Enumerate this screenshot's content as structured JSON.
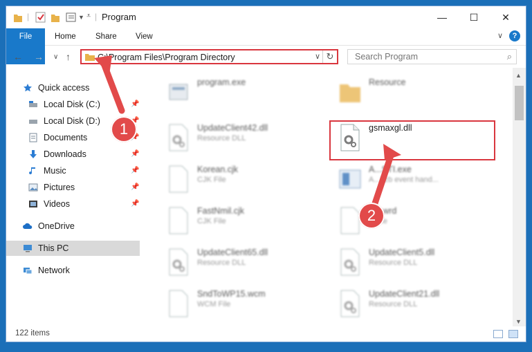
{
  "window": {
    "title": "Program",
    "controls": {
      "minimize": "—",
      "maximize": "☐",
      "close": "✕"
    }
  },
  "ribbon": {
    "tabs": [
      "File",
      "Home",
      "Share",
      "View"
    ],
    "expand": "∨",
    "help": "?"
  },
  "nav": {
    "back": "←",
    "forward": "→",
    "recent": "∨",
    "up": "↑"
  },
  "address": {
    "path": "C:\\Program Files\\Program Directory",
    "dropdown": "∨",
    "refresh": "↻"
  },
  "search": {
    "placeholder": "Search Program",
    "icon": "⌕"
  },
  "sidebar": {
    "items": [
      {
        "label": "Quick access",
        "icon": "star-icon"
      },
      {
        "label": "Local Disk (C:)",
        "icon": "drive-icon",
        "pinned": true
      },
      {
        "label": "Local Disk (D:)",
        "icon": "drive-icon",
        "pinned": true
      },
      {
        "label": "Documents",
        "icon": "documents-icon",
        "pinned": true
      },
      {
        "label": "Downloads",
        "icon": "downloads-icon",
        "pinned": true
      },
      {
        "label": "Music",
        "icon": "music-icon",
        "pinned": true
      },
      {
        "label": "Pictures",
        "icon": "pictures-icon",
        "pinned": true
      },
      {
        "label": "Videos",
        "icon": "videos-icon",
        "pinned": true
      },
      {
        "label": "OneDrive",
        "icon": "onedrive-icon"
      },
      {
        "label": "This PC",
        "icon": "pc-icon",
        "selected": true
      },
      {
        "label": "Network",
        "icon": "network-icon"
      }
    ],
    "pin_glyph": "📌"
  },
  "files": [
    {
      "name": "program.exe",
      "type": "",
      "icon": "exe-icon"
    },
    {
      "name": "Resource",
      "type": "",
      "icon": "folder-icon"
    },
    {
      "name": "UpdateClient42.dll",
      "type": "Resource DLL",
      "icon": "dll-icon"
    },
    {
      "name": "gsmaxgl.dll",
      "type": "",
      "icon": "dll-icon",
      "highlighted": true
    },
    {
      "name": "Korean.cjk",
      "type": "CJK File",
      "icon": "file-icon"
    },
    {
      "name": "A...STI.exe",
      "type": "A...I zb event hand...",
      "icon": "app-icon"
    },
    {
      "name": "FastNmil.cjk",
      "type": "CJK File",
      "icon": "file-icon"
    },
    {
      "name": "...c.wrd",
      "type": "...File",
      "icon": "file-icon"
    },
    {
      "name": "UpdateClient65.dll",
      "type": "Resource DLL",
      "icon": "dll-icon"
    },
    {
      "name": "UpdateClient5.dll",
      "type": "Resource DLL",
      "icon": "dll-icon"
    },
    {
      "name": "SndToWP15.wcm",
      "type": "WCM File",
      "icon": "file-icon"
    },
    {
      "name": "UpdateClient21.dll",
      "type": "Resource DLL",
      "icon": "dll-icon"
    }
  ],
  "status": {
    "count": "122 items"
  },
  "annotations": {
    "step1": "1",
    "step2": "2"
  },
  "colors": {
    "accent": "#1979ca",
    "highlight": "#d9363e",
    "badge": "#e24a4a"
  }
}
